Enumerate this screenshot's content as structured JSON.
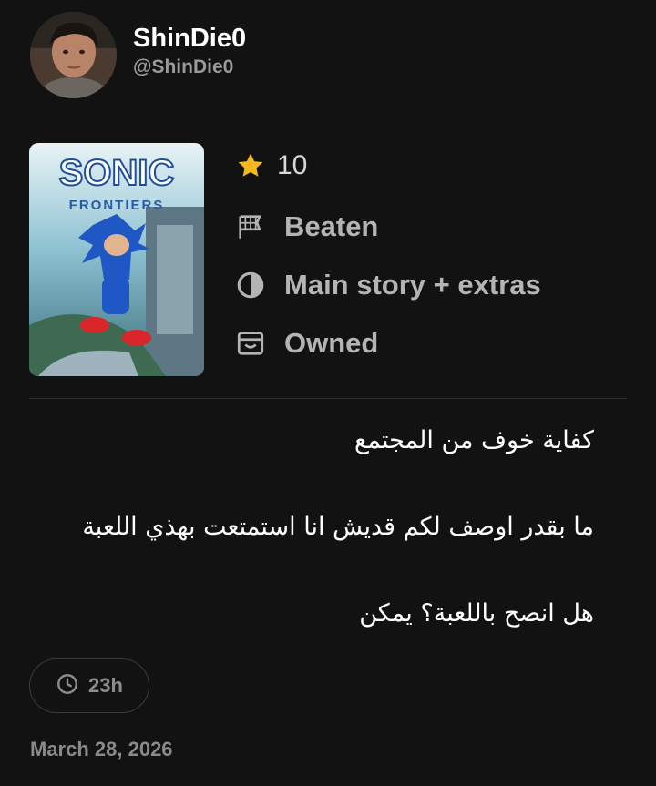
{
  "user": {
    "display_name": "ShinDie0",
    "handle": "@ShinDie0"
  },
  "game": {
    "cover_title": "SONIC",
    "cover_subtitle": "FRONTIERS"
  },
  "stats": {
    "rating": "10",
    "status": "Beaten",
    "completion": "Main story + extras",
    "ownership": "Owned"
  },
  "review": {
    "lines": [
      "كفاية خوف من المجتمع",
      "ما بقدر اوصف لكم قديش انا استمتعت بهذي اللعبة",
      "هل انصح باللعبة؟ يمكن"
    ]
  },
  "playtime": {
    "label": "23h"
  },
  "date": "March 28, 2026",
  "colors": {
    "background": "#121212",
    "star": "#f5b81f",
    "muted_text": "#b4b4b4",
    "chip_border": "#3b3b3b"
  },
  "icons": {
    "rating": "star-icon",
    "status": "flag-icon",
    "completion": "half-circle-icon",
    "ownership": "archive-box-icon",
    "playtime": "clock-icon"
  }
}
